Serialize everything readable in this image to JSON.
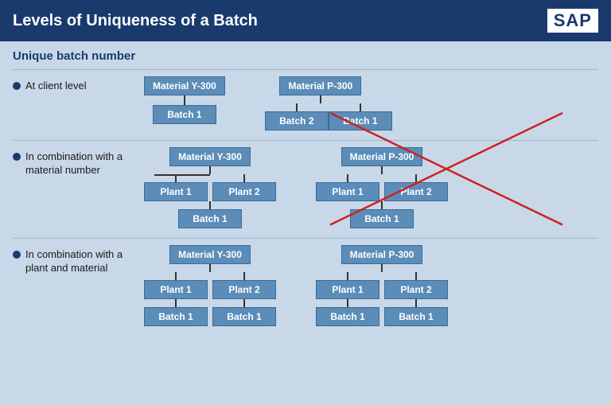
{
  "header": {
    "title": "Levels of Uniqueness of a Batch",
    "logo": "SAP"
  },
  "section": {
    "subtitle": "Unique batch number"
  },
  "rows": [
    {
      "id": "client-level",
      "label": "At client level",
      "diagrams": [
        {
          "id": "diag1",
          "root": "Material  Y-300",
          "children": [
            {
              "label": "Batch 1",
              "crossed": false
            }
          ]
        },
        {
          "id": "diag2",
          "root": "Material  P-300",
          "children": [
            {
              "label": "Batch 2",
              "crossed": false
            },
            {
              "label": "Batch 1",
              "crossed": true
            }
          ]
        }
      ]
    },
    {
      "id": "material-number",
      "label": "In combination with a material number",
      "diagrams": [
        {
          "id": "diag3",
          "root": "Material  Y-300",
          "level2": [
            "Plant 1",
            "Plant 2"
          ],
          "level3": "Batch 1"
        },
        {
          "id": "diag4",
          "root": "Material  P-300",
          "level2": [
            "Plant 1",
            "Plant 2"
          ],
          "level3": "Batch 1"
        }
      ]
    },
    {
      "id": "plant-material",
      "label": "In combination with a plant and material",
      "diagrams": [
        {
          "id": "diag5",
          "root": "Material  Y-300",
          "level2": [
            "Plant 1",
            "Plant 2"
          ],
          "level3": [
            "Batch 1",
            "Batch 1"
          ]
        },
        {
          "id": "diag6",
          "root": "Material  P-300",
          "level2": [
            "Plant 1",
            "Plant 2"
          ],
          "level3": [
            "Batch 1",
            "Batch 1"
          ]
        }
      ]
    }
  ]
}
